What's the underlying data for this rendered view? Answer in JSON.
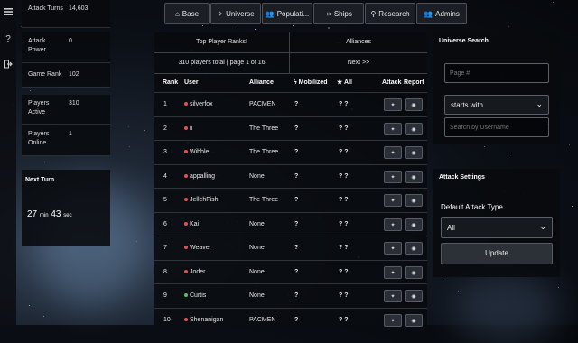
{
  "sidebar": {
    "icons": [
      "menu-icon",
      "question-icon",
      "logout-icon"
    ]
  },
  "stats": [
    {
      "label": "Attack Turns",
      "value": "14,603"
    },
    {
      "label": "Attack Power",
      "value": "0"
    },
    {
      "label": "Game Rank",
      "value": "102"
    },
    {
      "label": "Players Active",
      "value": "310"
    },
    {
      "label": "Players Online",
      "value": "1"
    }
  ],
  "next_turn": {
    "title": "Next Turn",
    "minutes": "27",
    "min_unit": "min",
    "seconds": "43",
    "sec_unit": "sec"
  },
  "nav": [
    {
      "label": "Base",
      "icon": "home-icon"
    },
    {
      "label": "Universe",
      "icon": "compass-icon"
    },
    {
      "label": "Populati...",
      "icon": "population-icon"
    },
    {
      "label": "Ships",
      "icon": "ships-icon"
    },
    {
      "label": "Research",
      "icon": "research-icon"
    },
    {
      "label": "Admins",
      "icon": "admins-icon"
    }
  ],
  "ranks": {
    "tab_players": "Top Player Ranks!",
    "tab_alliances": "Alliances",
    "summary": "310 players total | page 1 of 16",
    "next_label": "Next >>",
    "columns": {
      "rank": "Rank",
      "user": "User",
      "alliance": "Alliance",
      "mobilized": "Mobilized",
      "all": "All",
      "attack": "Attack",
      "report": "Report"
    },
    "rows": [
      {
        "rank": "1",
        "user": "silverfox",
        "alliance": "PACMEN",
        "mobilized": "?",
        "all": "? ?",
        "status": "red"
      },
      {
        "rank": "2",
        "user": "ii",
        "alliance": "The Three",
        "mobilized": "?",
        "all": "? ?",
        "status": "red"
      },
      {
        "rank": "3",
        "user": "Wibble",
        "alliance": "The Three",
        "mobilized": "?",
        "all": "? ?",
        "status": "red"
      },
      {
        "rank": "4",
        "user": "appalling",
        "alliance": "None",
        "mobilized": "?",
        "all": "? ?",
        "status": "red"
      },
      {
        "rank": "5",
        "user": "JellehFish",
        "alliance": "The Three",
        "mobilized": "?",
        "all": "? ?",
        "status": "red"
      },
      {
        "rank": "6",
        "user": "Kai",
        "alliance": "None",
        "mobilized": "?",
        "all": "? ?",
        "status": "red"
      },
      {
        "rank": "7",
        "user": "Weaver",
        "alliance": "None",
        "mobilized": "?",
        "all": "? ?",
        "status": "red"
      },
      {
        "rank": "8",
        "user": "Joder",
        "alliance": "None",
        "mobilized": "?",
        "all": "? ?",
        "status": "red"
      },
      {
        "rank": "9",
        "user": "Curtis",
        "alliance": "None",
        "mobilized": "?",
        "all": "? ?",
        "status": "green"
      },
      {
        "rank": "10",
        "user": "Shenanigan",
        "alliance": "PACMEN",
        "mobilized": "?",
        "all": "? ?",
        "status": "red"
      }
    ],
    "attack_icon": "✦",
    "report_icon": "◉"
  },
  "universe_search": {
    "title": "Universe Search",
    "page_placeholder": "Page #",
    "mode_selected": "starts with",
    "username_placeholder": "Search by Username"
  },
  "attack_settings": {
    "title": "Attack Settings",
    "type_label": "Default Attack Type",
    "type_selected": "All",
    "update_label": "Update"
  },
  "colors": {
    "status_red": "#e05252",
    "status_green": "#55c25a",
    "panel_bg": "#0a0c10"
  }
}
